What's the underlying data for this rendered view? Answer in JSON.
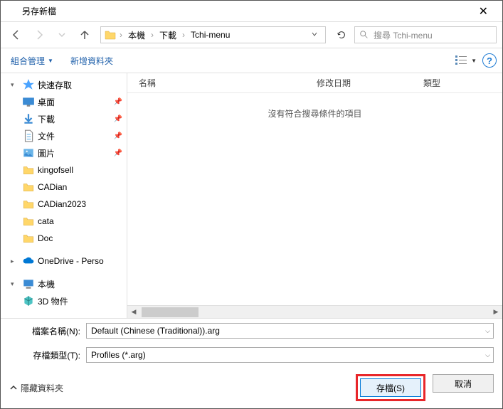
{
  "title": "另存新檔",
  "breadcrumb": {
    "parts": [
      "本機",
      "下載",
      "Tchi-menu"
    ]
  },
  "search": {
    "placeholder": "搜尋 Tchi-menu"
  },
  "toolbar": {
    "organize": "組合管理",
    "newfolder": "新增資料夾"
  },
  "columns": {
    "name": "名稱",
    "date": "修改日期",
    "type": "類型"
  },
  "empty_msg": "沒有符合搜尋條件的項目",
  "sidebar": {
    "quick": "快速存取",
    "desktop": "桌面",
    "downloads": "下載",
    "documents": "文件",
    "pictures": "圖片",
    "folders": [
      "kingofsell",
      "CADian",
      "CADian2023",
      "cata",
      "Doc"
    ],
    "onedrive": "OneDrive - Perso",
    "thispc": "本機",
    "obj3d": "3D 物件"
  },
  "filename": {
    "label": "檔案名稱(N):",
    "value": "Default (Chinese (Traditional)).arg"
  },
  "filetype": {
    "label": "存檔類型(T):",
    "value": "Profiles (*.arg)"
  },
  "hide_folders": "隱藏資料夾",
  "save_btn": "存檔(S)",
  "cancel_btn": "取消"
}
